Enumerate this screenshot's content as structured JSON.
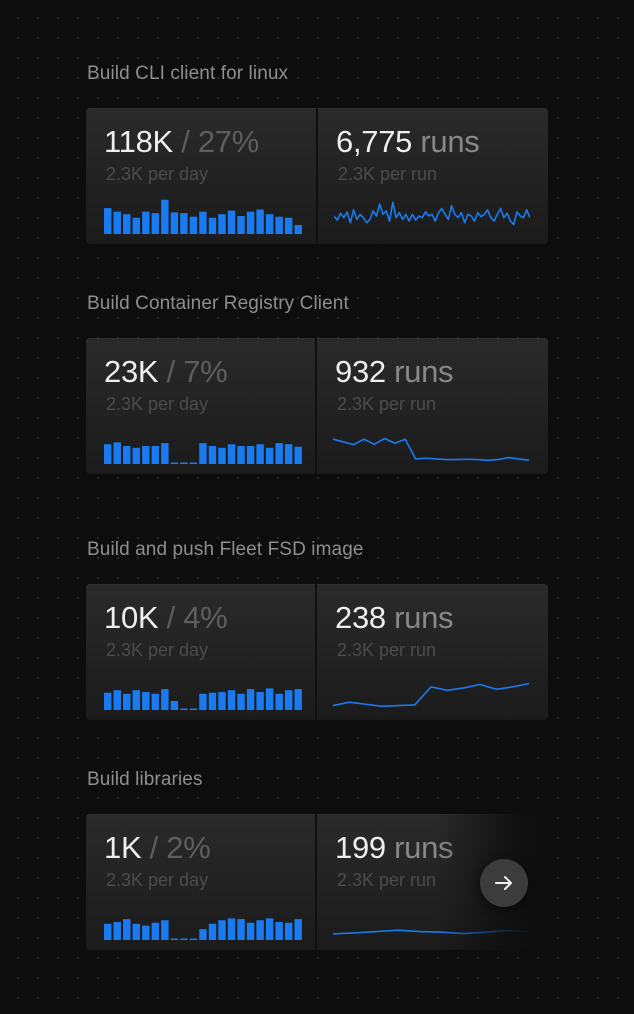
{
  "colors": {
    "accent": "#1a7bf0",
    "background": "#0d0d0d",
    "card": "#222222"
  },
  "builds": [
    {
      "title": "Build CLI client for linux",
      "total": "118K",
      "share": "/ 27%",
      "per_day": "2.3K per day",
      "runs": "6,775",
      "runs_label": "runs",
      "per_run": "2.3K per run",
      "bar_values": [
        0.72,
        0.62,
        0.55,
        0.45,
        0.62,
        0.58,
        0.95,
        0.6,
        0.58,
        0.48,
        0.62,
        0.45,
        0.55,
        0.65,
        0.5,
        0.62,
        0.68,
        0.55,
        0.48,
        0.45,
        0.25
      ],
      "run_trend": [
        0.5,
        0.38,
        0.58,
        0.45,
        0.62,
        0.3,
        0.68,
        0.4,
        0.55,
        0.45,
        0.3,
        0.4,
        0.65,
        0.5,
        0.85,
        0.55,
        0.65,
        0.35,
        0.9,
        0.45,
        0.6,
        0.4,
        0.55,
        0.35,
        0.55,
        0.38,
        0.5,
        0.45,
        0.62,
        0.5,
        0.55,
        0.35,
        0.6,
        0.72,
        0.55,
        0.4,
        0.8,
        0.55,
        0.45,
        0.6,
        0.3,
        0.55,
        0.5,
        0.35,
        0.6,
        0.48,
        0.55,
        0.68,
        0.45,
        0.35,
        0.55,
        0.72,
        0.45,
        0.58,
        0.35,
        0.25,
        0.62,
        0.5,
        0.45,
        0.68,
        0.45
      ]
    },
    {
      "title": "Build Container Registry Client",
      "total": "23K",
      "share": "/ 7%",
      "per_day": "2.3K per day",
      "runs": "932",
      "runs_label": "runs",
      "per_run": "2.3K per run",
      "bar_values": [
        0.55,
        0.6,
        0.5,
        0.45,
        0.5,
        0.5,
        0.58,
        0.04,
        0.04,
        0.04,
        0.58,
        0.5,
        0.45,
        0.55,
        0.5,
        0.5,
        0.55,
        0.45,
        0.58,
        0.55,
        0.48
      ],
      "run_trend": [
        0.7,
        0.62,
        0.54,
        0.7,
        0.55,
        0.72,
        0.58,
        0.7,
        0.12,
        0.14,
        0.12,
        0.1,
        0.1,
        0.11,
        0.1,
        0.08,
        0.1,
        0.16,
        0.12,
        0.08
      ]
    },
    {
      "title": "Build and push Fleet FSD image",
      "total": "10K",
      "share": "/ 4%",
      "per_day": "2.3K per day",
      "runs": "238",
      "runs_label": "runs",
      "per_run": "2.3K per run",
      "bar_values": [
        0.48,
        0.55,
        0.45,
        0.55,
        0.5,
        0.45,
        0.58,
        0.25,
        0.04,
        0.04,
        0.45,
        0.48,
        0.5,
        0.55,
        0.45,
        0.58,
        0.5,
        0.6,
        0.45,
        0.55,
        0.58
      ],
      "run_trend": [
        0.1,
        0.2,
        0.14,
        0.08,
        0.1,
        0.12,
        0.65,
        0.55,
        0.62,
        0.72,
        0.58,
        0.65,
        0.75
      ]
    },
    {
      "title": "Build libraries",
      "total": "1K",
      "share": "/ 2%",
      "per_day": "2.3K per day",
      "runs": "199",
      "runs_label": "runs",
      "per_run": "2.3K per run",
      "bar_values": [
        0.45,
        0.5,
        0.58,
        0.45,
        0.4,
        0.48,
        0.55,
        0.04,
        0.04,
        0.04,
        0.3,
        0.45,
        0.55,
        0.6,
        0.58,
        0.48,
        0.55,
        0.6,
        0.5,
        0.48,
        0.58
      ],
      "run_trend": [
        0.15,
        0.18,
        0.22,
        0.26,
        0.22,
        0.2,
        0.16,
        0.2,
        0.25,
        0.22
      ]
    }
  ],
  "next_button": {
    "icon": "arrow-right-icon"
  }
}
